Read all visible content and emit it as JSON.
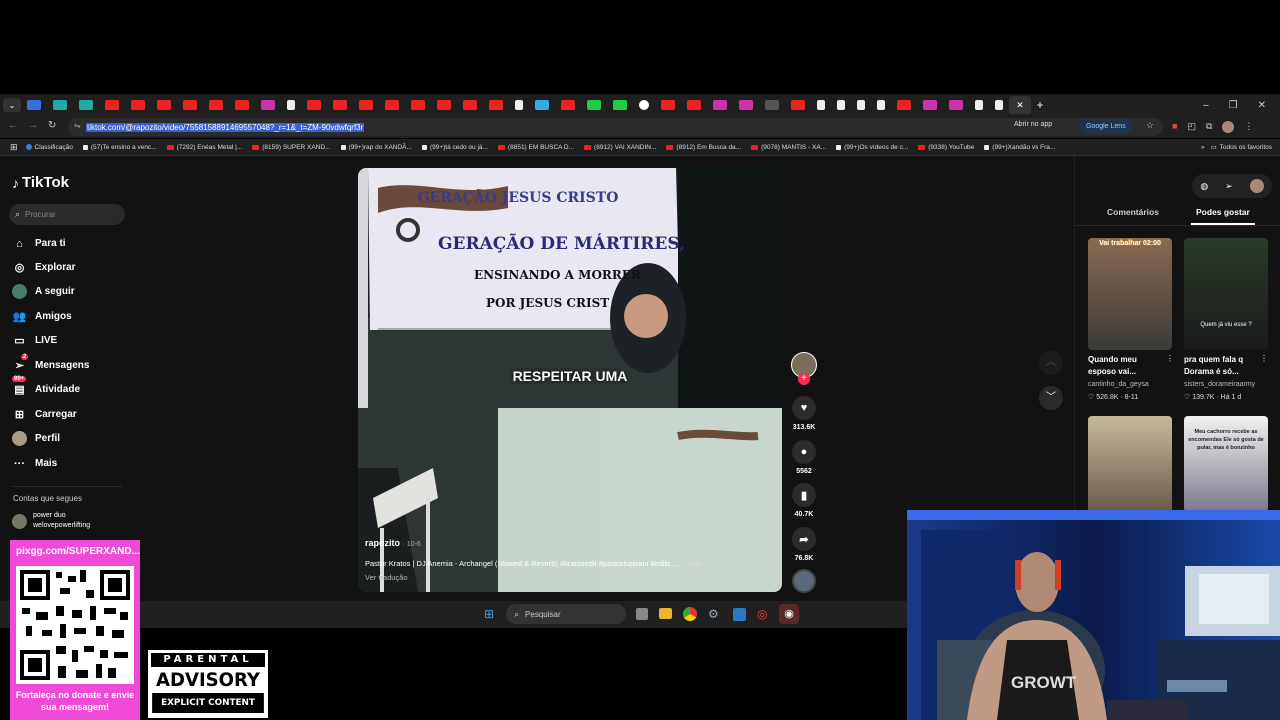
{
  "browser": {
    "url": "tiktok.com/@rapozito/video/7558158891469557048?_r=1&_t=ZM-90vdwfqrf3r",
    "lens_label": "Google Lens",
    "open_app_label": "Abrir no app",
    "bookmarks": [
      "Classificação",
      "(57)Te ensino a venc...",
      "(7292) Enéas Metal |...",
      "(8159) SUPER XAND...",
      "(99+)rap do XANDÃ...",
      "(99+)tá cedo ou já...",
      "(8851) EM BUSCA D...",
      "(8912) VAI XANDIN...",
      "(8912) Em Busca da...",
      "(9078) MANTIS - XA...",
      "(99+)Os vídeos de c...",
      "(9338) YouTube",
      "(99+)Xandão vs Fra..."
    ],
    "all_favorites": "Todos os favoritos"
  },
  "tiktok": {
    "logo": "TikTok",
    "search_placeholder": "Procurar",
    "nav": [
      {
        "label": "Para ti",
        "icon": "home-icon"
      },
      {
        "label": "Explorar",
        "icon": "compass-icon"
      },
      {
        "label": "A seguir",
        "icon": "avatar-icon"
      },
      {
        "label": "Amigos",
        "icon": "friends-icon"
      },
      {
        "label": "LIVE",
        "icon": "live-icon"
      },
      {
        "label": "Mensagens",
        "icon": "send-icon",
        "badge": "2"
      },
      {
        "label": "Atividade",
        "icon": "inbox-icon",
        "badge": "99+"
      },
      {
        "label": "Carregar",
        "icon": "upload-icon"
      },
      {
        "label": "Perfil",
        "icon": "profile-icon"
      },
      {
        "label": "Mais",
        "icon": "more-icon"
      }
    ],
    "following_heading": "Contas que segues",
    "following": [
      {
        "name": "power duo",
        "handle": "welovepowerlifting"
      }
    ],
    "video": {
      "banner_line1": "GERAÇÃO JESUS CRISTO",
      "banner_line2": "GERAÇÃO DE MÁRTIRES,",
      "banner_line3": "ENSINANDO A MORRER",
      "banner_line4": "POR JESUS CRIST",
      "overlay_text": "RESPEITAR UMA",
      "author": "rapozito",
      "date": "10-6",
      "description": "Pastor Kratos | DJ Anemia - Archangel (Slowed & Reverb) #kratosedit #pastortupirani #edits ...",
      "more": "mais",
      "translate": "Ver tradução"
    },
    "actions": {
      "likes": "313.6K",
      "comments": "5562",
      "saves": "40.7K",
      "shares": "76.8K"
    },
    "panel": {
      "tab_comments": "Comentários",
      "tab_like": "Podes gostar",
      "items": [
        {
          "title": "Quando meu esposo vai...",
          "user": "cantinho_da_geysa",
          "views": "526.8K",
          "date": "8-11",
          "overlay": "Vai trabalhar 02:00"
        },
        {
          "title": "pra quem fala q Dorama é só...",
          "user": "sisters_dorameiraarmy",
          "views": "139.7K",
          "date": "Há 1 d",
          "overlay": "Quem já viu esse ?"
        },
        {
          "title": "",
          "user": "",
          "views": "",
          "date": "",
          "overlay": ""
        },
        {
          "title": "",
          "user": "",
          "views": "",
          "date": "",
          "overlay": "Meu cachorro recebe as encomendas Ele só gosta de pular, mas é bonzinho"
        }
      ]
    }
  },
  "taskbar": {
    "search_placeholder": "Pesquisar"
  },
  "overlay": {
    "pix_url": "pixgg.com/SUPERXAND...",
    "donate_text": "Fortaleça no donate e envie sua mensagem!",
    "advisory_top": "PARENTAL",
    "advisory_main": "ADVISORY",
    "advisory_bottom": "EXPLICIT CONTENT"
  },
  "colors": {
    "tiktok_red": "#fe2c55",
    "pix_pink": "#f04ad8",
    "selection_blue": "#3a5fd0"
  }
}
